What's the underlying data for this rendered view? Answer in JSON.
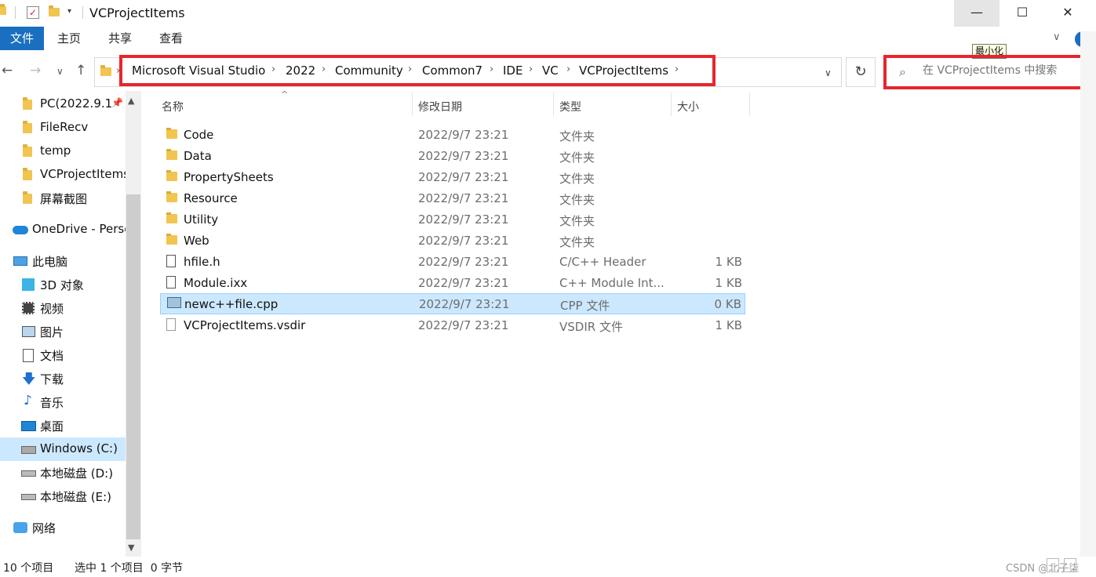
{
  "window": {
    "title": "VCProjectItems",
    "minimize_glyph": "—",
    "maximize_glyph": "☐",
    "close_glyph": "✕",
    "tooltip": "最小化"
  },
  "ribbon": {
    "tabs": [
      "文件",
      "主页",
      "共享",
      "查看"
    ],
    "expand_glyph": "∨",
    "help_glyph": "?"
  },
  "nav": {
    "back": "←",
    "forward": "→",
    "recent": "∨",
    "up": "↑",
    "crumbs": [
      "Microsoft Visual Studio",
      "2022",
      "Community",
      "Common7",
      "IDE",
      "VC",
      "VCProjectItems"
    ],
    "separator": "›",
    "dropdown": "∨",
    "refresh": "↻"
  },
  "search": {
    "placeholder": "在 VCProjectItems 中搜索",
    "icon": "search-icon"
  },
  "sidebar": {
    "items": [
      {
        "label": "PC(2022.9.1",
        "icon": "folder-icon",
        "pinned": true
      },
      {
        "label": "FileRecv",
        "icon": "folder-icon"
      },
      {
        "label": "temp",
        "icon": "folder-icon"
      },
      {
        "label": "VCProjectItems",
        "icon": "folder-icon"
      },
      {
        "label": "屏幕截图",
        "icon": "folder-icon"
      },
      {
        "label": "OneDrive - Perso",
        "icon": "cloud-icon"
      },
      {
        "label": "此电脑",
        "icon": "computer-icon"
      },
      {
        "label": "3D 对象",
        "icon": "cube-icon"
      },
      {
        "label": "视频",
        "icon": "video-icon"
      },
      {
        "label": "图片",
        "icon": "picture-icon"
      },
      {
        "label": "文档",
        "icon": "document-icon"
      },
      {
        "label": "下载",
        "icon": "download-icon"
      },
      {
        "label": "音乐",
        "icon": "music-icon"
      },
      {
        "label": "桌面",
        "icon": "desktop-icon"
      },
      {
        "label": "Windows (C:)",
        "icon": "drive-icon",
        "selected": true
      },
      {
        "label": "本地磁盘 (D:)",
        "icon": "drive-icon"
      },
      {
        "label": "本地磁盘 (E:)",
        "icon": "drive-icon"
      },
      {
        "label": "网络",
        "icon": "network-icon"
      }
    ]
  },
  "list": {
    "columns": [
      "名称",
      "修改日期",
      "类型",
      "大小"
    ],
    "sort_glyph": "^",
    "rows": [
      {
        "name": "Code",
        "date": "2022/9/7 23:21",
        "type": "文件夹",
        "size": "",
        "kind": "folder"
      },
      {
        "name": "Data",
        "date": "2022/9/7 23:21",
        "type": "文件夹",
        "size": "",
        "kind": "folder"
      },
      {
        "name": "PropertySheets",
        "date": "2022/9/7 23:21",
        "type": "文件夹",
        "size": "",
        "kind": "folder"
      },
      {
        "name": "Resource",
        "date": "2022/9/7 23:21",
        "type": "文件夹",
        "size": "",
        "kind": "folder"
      },
      {
        "name": "Utility",
        "date": "2022/9/7 23:21",
        "type": "文件夹",
        "size": "",
        "kind": "folder"
      },
      {
        "name": "Web",
        "date": "2022/9/7 23:21",
        "type": "文件夹",
        "size": "",
        "kind": "folder"
      },
      {
        "name": "hfile.h",
        "date": "2022/9/7 23:21",
        "type": "C/C++ Header",
        "size": "1 KB",
        "kind": "header"
      },
      {
        "name": "Module.ixx",
        "date": "2022/9/7 23:21",
        "type": "C++ Module Int...",
        "size": "1 KB",
        "kind": "doc"
      },
      {
        "name": "newc++file.cpp",
        "date": "2022/9/7 23:21",
        "type": "CPP 文件",
        "size": "0 KB",
        "kind": "cpp",
        "selected": true
      },
      {
        "name": "VCProjectItems.vsdir",
        "date": "2022/9/7 23:21",
        "type": "VSDIR 文件",
        "size": "1 KB",
        "kind": "blank"
      }
    ]
  },
  "status": {
    "count": "10 个项目",
    "selection": "选中 1 个项目  0 字节",
    "watermark": "CSDN @北子柒"
  }
}
